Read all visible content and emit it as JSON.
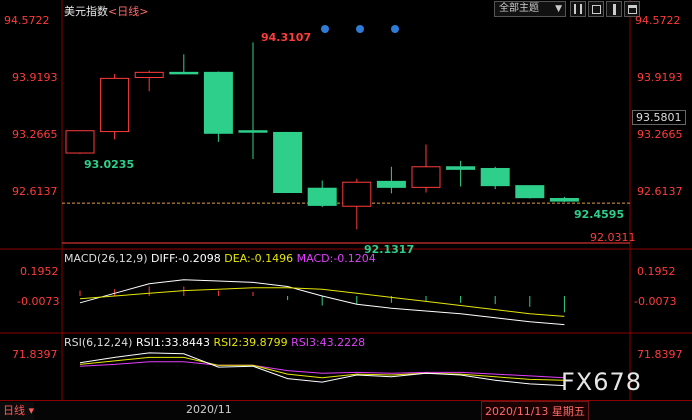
{
  "header": {
    "title": "美元指数",
    "timeframe": "<日线>",
    "theme_button": "全部主题"
  },
  "price_axis": {
    "ticks": [
      "94.5722",
      "93.9193",
      "93.2665",
      "92.6137"
    ],
    "current_price": "93.5801",
    "line_price": "92.0311"
  },
  "annotations": {
    "high": "94.3107",
    "low": "92.1317",
    "left_point": "93.0235",
    "right_point": "92.4595"
  },
  "macd": {
    "header": "MACD(26,12,9)",
    "diff": "DIFF:-0.2098",
    "dea": "DEA:-0.1496",
    "macd": "MACD:-0.1204",
    "ticks": [
      "0.1952",
      "-0.0073"
    ]
  },
  "rsi": {
    "header": "RSI(6,12,24)",
    "rsi1": "RSI1:33.8443",
    "rsi2": "RSI2:39.8799",
    "rsi3": "RSI3:43.2228",
    "ticks": [
      "71.8397"
    ]
  },
  "footer": {
    "timeframe_tab": "日线 ▾",
    "date_label": "2020/11",
    "cursor_date": "2020/11/13 星期五"
  },
  "watermark": "FX678",
  "colors": {
    "up": "#ff3b3b",
    "down": "#2ecf8b",
    "diff": "#ffffff",
    "dea": "#e6e600",
    "macd_label": "#e040fb",
    "rsi1": "#ffffff",
    "rsi2": "#e6e600",
    "rsi3": "#e040fb"
  },
  "chart_data": {
    "type": "candlestick",
    "candles": [
      {
        "o": 93.02,
        "h": 93.28,
        "l": 93.01,
        "c": 93.28
      },
      {
        "o": 93.27,
        "h": 93.94,
        "l": 93.18,
        "c": 93.89
      },
      {
        "o": 93.9,
        "h": 93.98,
        "l": 93.74,
        "c": 93.96
      },
      {
        "o": 93.96,
        "h": 94.17,
        "l": 93.94,
        "c": 93.95
      },
      {
        "o": 93.96,
        "h": 93.97,
        "l": 93.15,
        "c": 93.25
      },
      {
        "o": 93.28,
        "h": 94.31,
        "l": 92.95,
        "c": 93.27
      },
      {
        "o": 93.26,
        "h": 93.26,
        "l": 92.56,
        "c": 92.56
      },
      {
        "o": 92.61,
        "h": 92.7,
        "l": 92.39,
        "c": 92.41
      },
      {
        "o": 92.4,
        "h": 92.72,
        "l": 92.13,
        "c": 92.68
      },
      {
        "o": 92.69,
        "h": 92.86,
        "l": 92.55,
        "c": 92.62
      },
      {
        "o": 92.62,
        "h": 93.12,
        "l": 92.56,
        "c": 92.86
      },
      {
        "o": 92.86,
        "h": 92.93,
        "l": 92.63,
        "c": 92.83
      },
      {
        "o": 92.84,
        "h": 92.86,
        "l": 92.6,
        "c": 92.64
      },
      {
        "o": 92.64,
        "h": 92.64,
        "l": 92.49,
        "c": 92.5
      },
      {
        "o": 92.49,
        "h": 92.51,
        "l": 92.45,
        "c": 92.46
      }
    ],
    "ylim": [
      92.03,
      94.57
    ],
    "macd_hist": [
      0.04,
      0.05,
      0.07,
      0.07,
      0.04,
      0.03,
      -0.03,
      -0.07,
      -0.06,
      -0.05,
      -0.04,
      -0.05,
      -0.06,
      -0.08,
      -0.12
    ],
    "diff": [
      -0.05,
      0.02,
      0.09,
      0.12,
      0.11,
      0.1,
      0.07,
      0.0,
      -0.06,
      -0.09,
      -0.11,
      -0.13,
      -0.16,
      -0.19,
      -0.21
    ],
    "dea": [
      -0.02,
      0.0,
      0.02,
      0.04,
      0.05,
      0.06,
      0.06,
      0.05,
      0.02,
      -0.01,
      -0.04,
      -0.07,
      -0.1,
      -0.13,
      -0.15
    ],
    "rsi1": [
      60,
      66,
      71,
      70,
      55,
      56,
      42,
      38,
      46,
      44,
      48,
      46,
      40,
      36,
      34
    ],
    "rsi2": [
      58,
      62,
      66,
      66,
      57,
      57,
      47,
      43,
      47,
      46,
      48,
      47,
      44,
      41,
      40
    ],
    "rsi3": [
      56,
      58,
      61,
      61,
      57,
      57,
      51,
      48,
      49,
      48,
      49,
      49,
      47,
      45,
      43
    ],
    "dots": 3
  }
}
